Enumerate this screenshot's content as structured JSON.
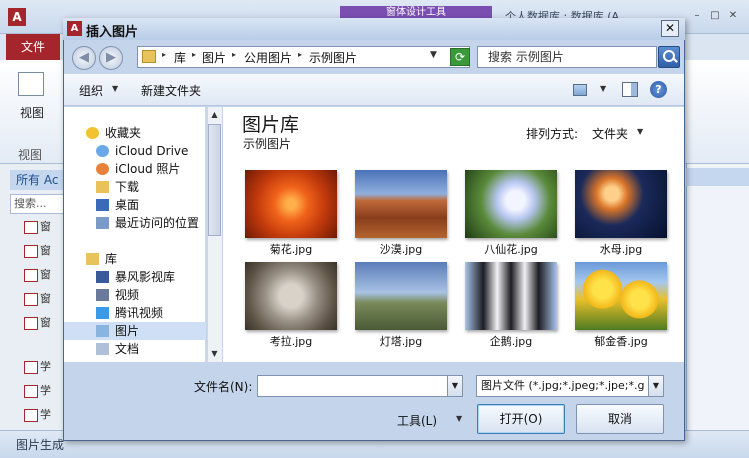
{
  "background_app": {
    "app_icon": "A",
    "contextual_tab": "窗体设计工具",
    "window_title": "个人数据库 : 数据库 (A",
    "window_controls": [
      "–",
      "□",
      "✕"
    ],
    "file_tab": "文件",
    "view_button": "视图",
    "view_group": "视图",
    "nav_header": "所有 Ac",
    "nav_search": "搜索...",
    "nav_items": [
      "窗",
      "窗",
      "窗",
      "窗",
      "窗",
      "学",
      "学",
      "学"
    ],
    "status_text": "图片生成"
  },
  "dialog": {
    "title": "插入图片",
    "icon": "A",
    "close": "✕",
    "nav": {
      "back": "◀",
      "forward": "▶"
    },
    "address": [
      "库",
      "图片",
      "公用图片",
      "示例图片"
    ],
    "search_placeholder": "搜索 示例图片",
    "toolbar": {
      "organize": "组织",
      "new_folder": "新建文件夹"
    },
    "tree": [
      {
        "label": "收藏夹",
        "icon": "star-icon",
        "indent": 0
      },
      {
        "label": "iCloud Drive",
        "icon": "cloud-icon",
        "indent": 1
      },
      {
        "label": "iCloud 照片",
        "icon": "photos-icon",
        "indent": 1
      },
      {
        "label": "下载",
        "icon": "download-folder-icon",
        "indent": 1
      },
      {
        "label": "桌面",
        "icon": "desktop-icon",
        "indent": 1
      },
      {
        "label": "最近访问的位置",
        "icon": "recent-places-icon",
        "indent": 1
      },
      {
        "label": "库",
        "icon": "library-icon",
        "indent": 0
      },
      {
        "label": "暴风影视库",
        "icon": "video-library-icon",
        "indent": 1
      },
      {
        "label": "视频",
        "icon": "video-icon",
        "indent": 1
      },
      {
        "label": "腾讯视频",
        "icon": "tencent-video-icon",
        "indent": 1
      },
      {
        "label": "图片",
        "icon": "pictures-icon",
        "indent": 1,
        "selected": true
      },
      {
        "label": "文档",
        "icon": "documents-icon",
        "indent": 1
      }
    ],
    "library_title": "图片库",
    "library_subtitle": "示例图片",
    "sort_label": "排列方式:",
    "sort_value": "文件夹",
    "files": [
      {
        "name": "菊花.jpg",
        "thumb": "chrysanthemum"
      },
      {
        "name": "沙漠.jpg",
        "thumb": "desert"
      },
      {
        "name": "八仙花.jpg",
        "thumb": "hydrangeas"
      },
      {
        "name": "水母.jpg",
        "thumb": "jellyfish"
      },
      {
        "name": "考拉.jpg",
        "thumb": "koala"
      },
      {
        "name": "灯塔.jpg",
        "thumb": "lighthouse"
      },
      {
        "name": "企鹅.jpg",
        "thumb": "penguins"
      },
      {
        "name": "郁金香.jpg",
        "thumb": "tulips"
      }
    ],
    "filename_label": "文件名(N):",
    "filename_value": "",
    "filetype_value": "图片文件 (*.jpg;*.jpeg;*.jpe;*.g",
    "tools_label": "工具(L)",
    "open_button": "打开(O)",
    "cancel_button": "取消"
  }
}
